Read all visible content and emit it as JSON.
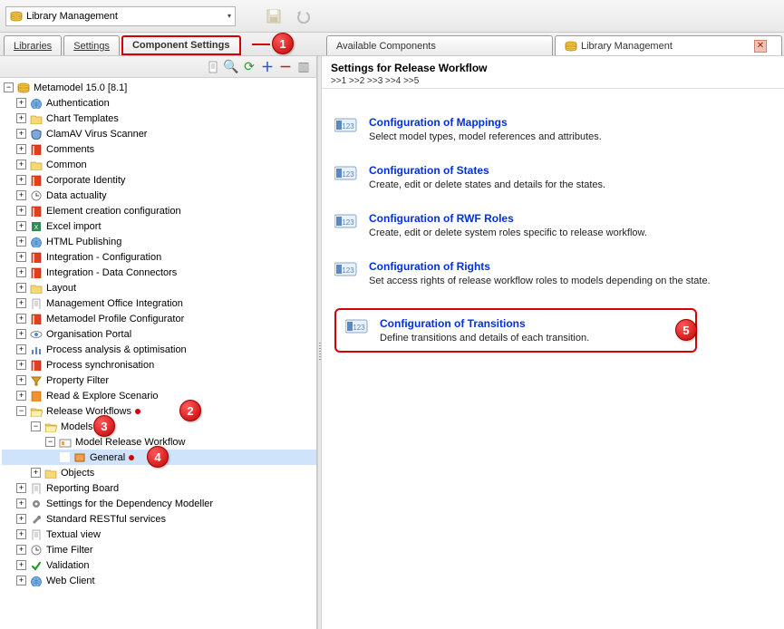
{
  "topbar": {
    "dropdown_label": "Library Management"
  },
  "tabs_left": [
    {
      "label": "Libraries"
    },
    {
      "label": "Settings"
    },
    {
      "label": "Component Settings"
    }
  ],
  "tabs_right": [
    {
      "label": "Available Components"
    },
    {
      "label": "Library Management"
    }
  ],
  "callouts": {
    "c1": "1",
    "c2": "2",
    "c3": "3",
    "c4": "4",
    "c5": "5"
  },
  "tree": {
    "root": "Metamodel 15.0 [8.1]",
    "items": [
      {
        "label": "Authentication",
        "icon": "globe"
      },
      {
        "label": "Chart Templates",
        "icon": "folder"
      },
      {
        "label": "ClamAV Virus Scanner",
        "icon": "shield"
      },
      {
        "label": "Comments",
        "icon": "book-red"
      },
      {
        "label": "Common",
        "icon": "folder"
      },
      {
        "label": "Corporate Identity",
        "icon": "book-red"
      },
      {
        "label": "Data actuality",
        "icon": "clock"
      },
      {
        "label": "Element creation configuration",
        "icon": "book-red"
      },
      {
        "label": "Excel import",
        "icon": "excel"
      },
      {
        "label": "HTML Publishing",
        "icon": "globe"
      },
      {
        "label": "Integration - Configuration",
        "icon": "book-red"
      },
      {
        "label": "Integration - Data Connectors",
        "icon": "book-red"
      },
      {
        "label": "Layout",
        "icon": "folder"
      },
      {
        "label": "Management Office Integration",
        "icon": "doc"
      },
      {
        "label": "Metamodel Profile Configurator",
        "icon": "book-red"
      },
      {
        "label": "Organisation Portal",
        "icon": "eye"
      },
      {
        "label": "Process analysis & optimisation",
        "icon": "chart"
      },
      {
        "label": "Process synchronisation",
        "icon": "book-red"
      },
      {
        "label": "Property Filter",
        "icon": "filter"
      },
      {
        "label": "Read & Explore Scenario",
        "icon": "book-orange"
      }
    ],
    "rw": {
      "label": "Release Workflows",
      "models": "Models",
      "mrw": "Model Release Workflow",
      "general": "General",
      "objects": "Objects"
    },
    "items2": [
      {
        "label": "Reporting Board",
        "icon": "doc"
      },
      {
        "label": "Settings for the Dependency Modeller",
        "icon": "gear"
      },
      {
        "label": "Standard RESTful services",
        "icon": "wrench"
      },
      {
        "label": "Textual view",
        "icon": "doc"
      },
      {
        "label": "Time Filter",
        "icon": "clock"
      },
      {
        "label": "Validation",
        "icon": "check"
      },
      {
        "label": "Web Client",
        "icon": "globe"
      }
    ]
  },
  "right": {
    "title": "Settings for Release Workflow",
    "breadcrumb": ">>1 >>2 >>3 >>4 >>5",
    "items": [
      {
        "link": "Configuration of Mappings",
        "desc": "Select model types, model references and attributes."
      },
      {
        "link": "Configuration of States",
        "desc": "Create, edit or delete states and details for the states."
      },
      {
        "link": "Configuration of RWF Roles",
        "desc": "Create, edit or delete system roles specific to release workflow."
      },
      {
        "link": "Configuration of Rights",
        "desc": "Set access rights of release workflow roles to models depending on the state."
      },
      {
        "link": "Configuration of Transitions",
        "desc": "Define transitions and details of each transition."
      }
    ]
  }
}
